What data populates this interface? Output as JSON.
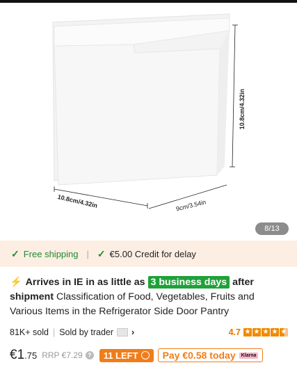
{
  "product_image": {
    "width_label": "10.8cm/4.32in",
    "depth_label": "9cm/3.54in",
    "height_label": "10.8cm/4.32in",
    "counter": "8/13"
  },
  "promo": {
    "free_shipping": "Free shipping",
    "delay_credit": "€5.00 Credit for delay"
  },
  "title": {
    "arrives_prefix": "Arrives in IE in as little as",
    "days": "3 business days",
    "arrives_suffix": "after shipment",
    "description": "Classification of Food, Vegetables, Fruits and Various Items in the Refrigerator Side Door Pantry"
  },
  "meta": {
    "sold": "81K+ sold",
    "seller": "Sold by trader",
    "rating": "4.7",
    "rating_value": 4.7
  },
  "price": {
    "currency_whole": "€1",
    "cents": ".75",
    "rrp": "RRP €7.29",
    "left_badge": "11 LEFT",
    "klarna": "Pay €0.58 today",
    "klarna_logo": "Klarna"
  },
  "colors": {
    "accent_green": "#1e8b2f",
    "badge_green": "#20a13a",
    "orange": "#f07d1a",
    "promo_bg": "#fdeee3"
  }
}
